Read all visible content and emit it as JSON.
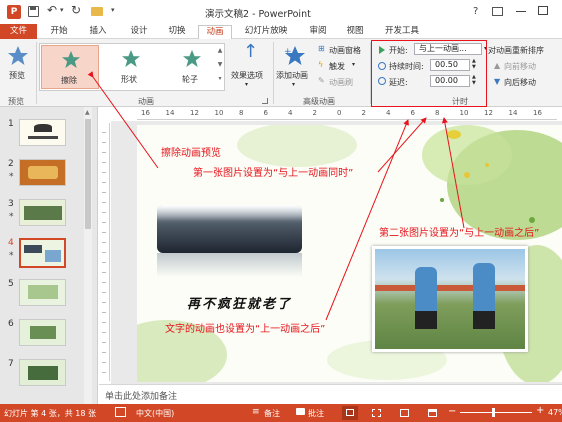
{
  "title_bar": {
    "title": "演示文稿2 - PowerPoint",
    "help": "?"
  },
  "tabs": [
    "文件",
    "开始",
    "插入",
    "设计",
    "切换",
    "动画",
    "幻灯片放映",
    "审阅",
    "视图",
    "开发工具"
  ],
  "active_tab": "动画",
  "ribbon": {
    "preview_label": "预览",
    "group_preview": "预览",
    "animations": [
      "擦除",
      "形状",
      "轮子"
    ],
    "effect_options_label": "效果选项",
    "group_animation": "动画",
    "add_animation_label": "添加动画",
    "animation_pane_label": "动画窗格",
    "trigger_label": "触发",
    "animation_painter_label": "动画刷",
    "group_advanced": "高级动画",
    "start_label": "开始:",
    "start_value": "与上一动画...",
    "duration_label": "持续时间:",
    "duration_value": "00.50",
    "delay_label": "延迟:",
    "delay_value": "00.00",
    "group_timing": "计时",
    "reorder_label": "对动画重新排序",
    "move_earlier_label": "向前移动",
    "move_later_label": "向后移动"
  },
  "slides": [
    {
      "num": "1",
      "star": ""
    },
    {
      "num": "2",
      "star": "*"
    },
    {
      "num": "3",
      "star": "*"
    },
    {
      "num": "4",
      "star": "*"
    },
    {
      "num": "5",
      "star": ""
    },
    {
      "num": "6",
      "star": ""
    },
    {
      "num": "7",
      "star": ""
    }
  ],
  "selected_slide": "4",
  "ruler_numbers": [
    "16",
    "14",
    "12",
    "10",
    "8",
    "6",
    "4",
    "2",
    "0",
    "2",
    "4",
    "6",
    "8",
    "10",
    "12",
    "14",
    "16"
  ],
  "slide_text": "再不疯狂就老了",
  "annotations": {
    "a1": "擦除动画预览",
    "a2": "第一张图片设置为“与上一动画同时”",
    "a3": "第二张图片设置为“与上一动画之后”",
    "a4": "文字的动画也设置为“上一动画之后”"
  },
  "notes_placeholder": "单击此处添加备注",
  "status": {
    "slide_info": "幻灯片 第 4 张，共 18 张",
    "language": "中文(中国)",
    "notes_btn": "备注",
    "comments_btn": "批注",
    "zoom": "47%"
  },
  "colors": {
    "accent": "#d24726",
    "annotation": "#e8131b"
  }
}
